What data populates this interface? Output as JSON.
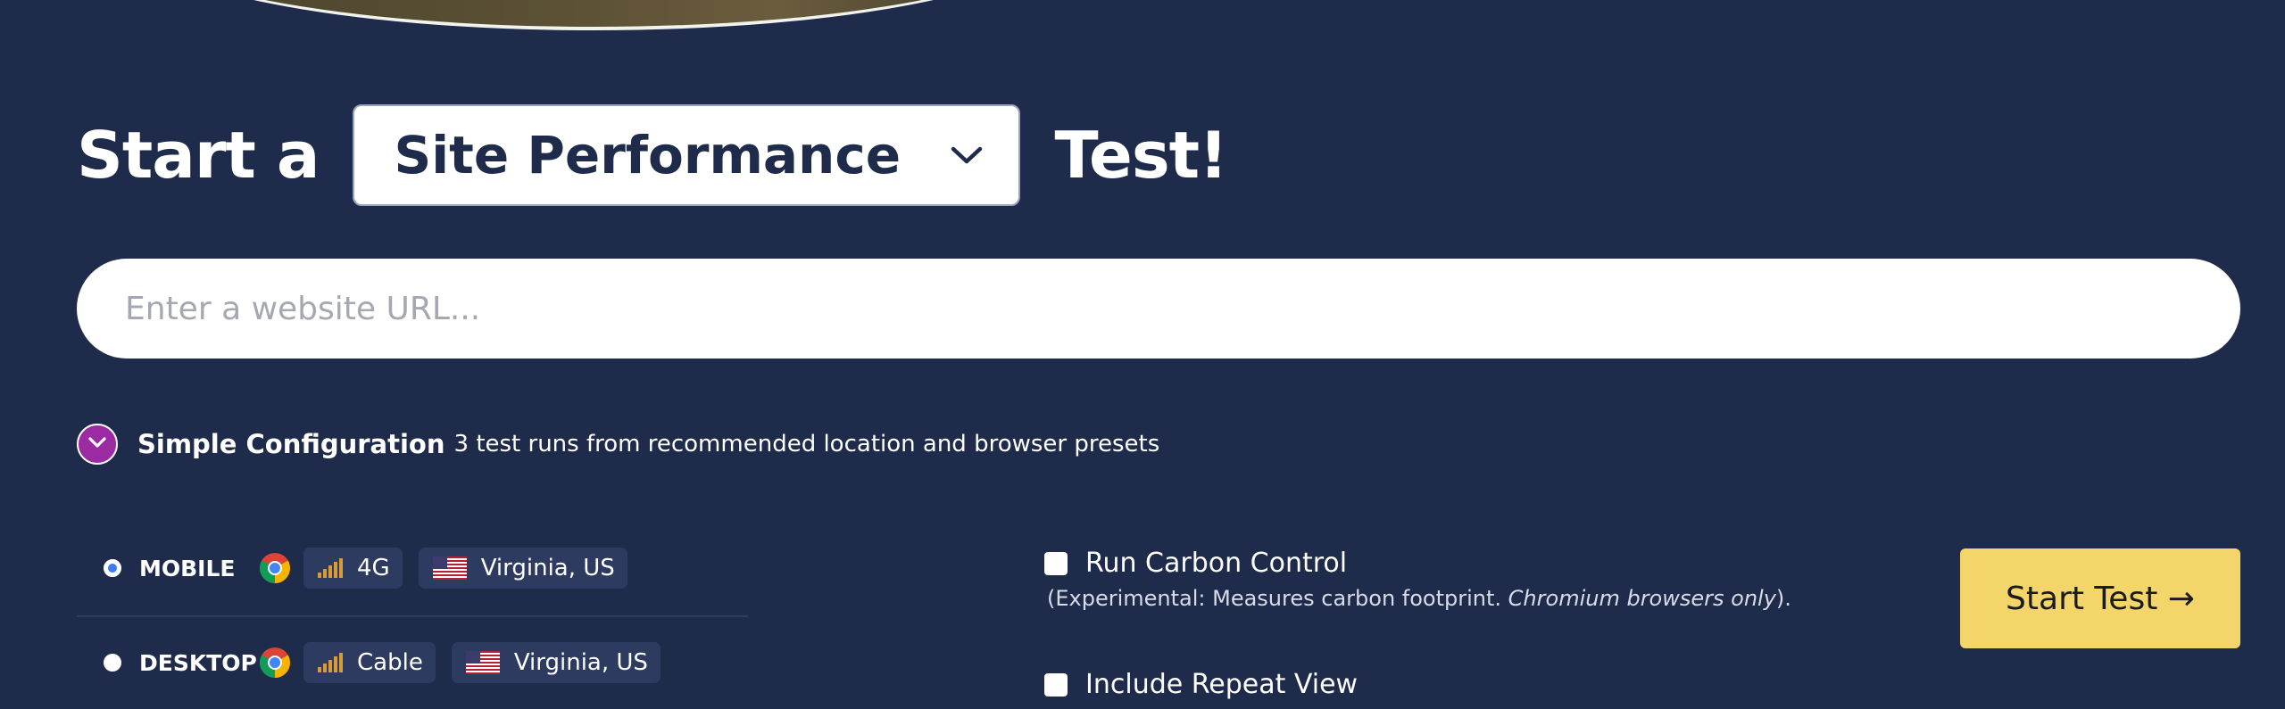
{
  "heading": {
    "prefix": "Start a",
    "suffix": "Test!"
  },
  "test_type": {
    "selected": "Site Performance",
    "icon": "chevron-down-icon"
  },
  "url_input": {
    "placeholder": "Enter a website URL...",
    "value": ""
  },
  "simple_config": {
    "title": "Simple Configuration",
    "description": "3 test runs from recommended location and browser presets",
    "icon": "chevron-down-icon",
    "color": "#9b2aa3"
  },
  "presets": [
    {
      "label": "MOBILE",
      "selected": true,
      "browser_icon": "chrome-icon",
      "connection": "4G",
      "connection_icon": "signal-bars-icon",
      "location": "Virginia, US",
      "location_icon": "us-flag-icon"
    },
    {
      "label": "DESKTOP",
      "selected": false,
      "browser_icon": "chrome-icon",
      "connection": "Cable",
      "connection_icon": "signal-bars-icon",
      "location": "Virginia, US",
      "location_icon": "us-flag-icon"
    }
  ],
  "options": {
    "carbon": {
      "label": "Run Carbon Control",
      "note_prefix": "(Experimental: Measures carbon footprint.",
      "note_emphasis": "Chromium browsers only",
      "note_suffix": ").",
      "checked": false
    },
    "repeat": {
      "label": "Include Repeat View",
      "checked": false
    }
  },
  "start_button": {
    "label": "Start Test →",
    "color": "#f3d56a"
  },
  "colors": {
    "background": "#1f2b4b",
    "pill": "#2e3b60",
    "radio_selected": "#3b7cf4"
  }
}
